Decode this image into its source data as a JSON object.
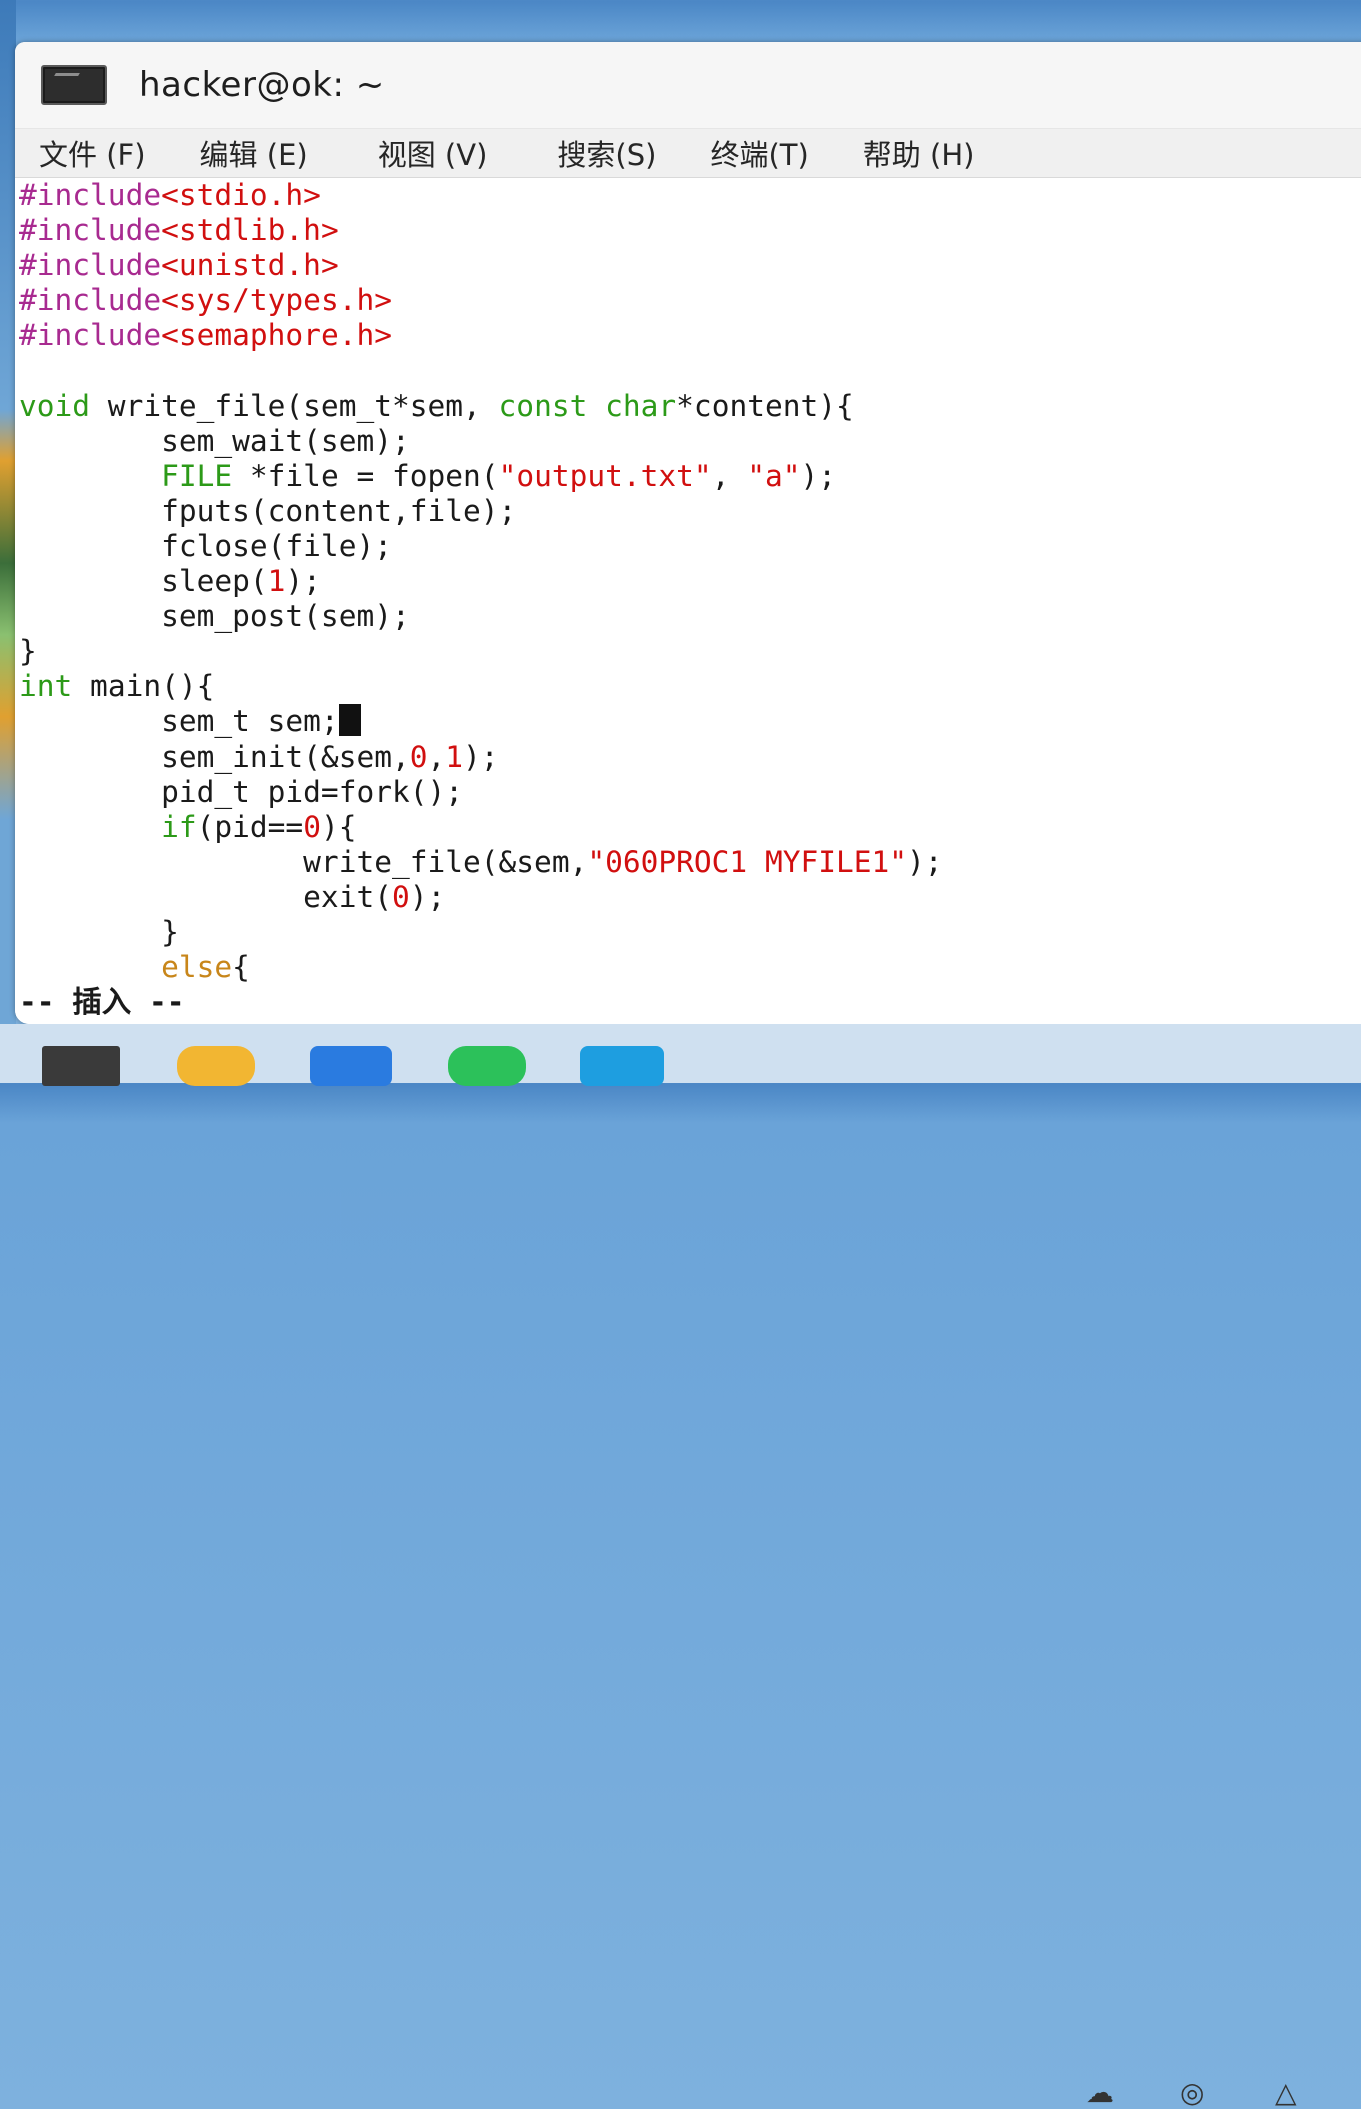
{
  "window": {
    "title": "hacker@ok: ~"
  },
  "menu": [
    "文件 (F)",
    "编辑 (E)",
    "视图 (V)",
    "搜索(S)",
    "终端(T)",
    "帮助 (H)"
  ],
  "code": {
    "includes": [
      {
        "directive": "#include",
        "header": "<stdio.h>"
      },
      {
        "directive": "#include",
        "header": "<stdlib.h>"
      },
      {
        "directive": "#include",
        "header": "<unistd.h>"
      },
      {
        "directive": "#include",
        "header": "<sys/types.h>"
      },
      {
        "directive": "#include",
        "header": "<semaphore.h>"
      }
    ],
    "fn_sig": {
      "ret": "void",
      "name": " write_file(sem_t*sem, ",
      "kw1": "const",
      "kw2": "char",
      "rest": "*content){"
    },
    "fn_body": {
      "l1": "        sem_wait(sem);",
      "l2_type": "FILE",
      "l2_a": " *file = fopen(",
      "l2_s1": "\"output.txt\"",
      "l2_b": ", ",
      "l2_s2": "\"a\"",
      "l2_c": ");",
      "l3": "        fputs(content,file);",
      "l4": "        fclose(file);",
      "l5_a": "        sleep(",
      "l5_n": "1",
      "l5_b": ");",
      "l6": "        sem_post(sem);",
      "close": "}"
    },
    "main": {
      "kw": "int",
      "sig": " main(){",
      "l1": "        sem_t sem;",
      "l2_a": "        sem_init(&sem,",
      "l2_n1": "0",
      "l2_b": ",",
      "l2_n2": "1",
      "l2_c": ");",
      "l3": "        pid_t pid=fork();",
      "l4_kw": "if",
      "l4_a": "(pid==",
      "l4_n": "0",
      "l4_b": "){",
      "l5_a": "                write_file(&sem,",
      "l5_s": "\"060PROC1 MYFILE1\"",
      "l5_b": ");",
      "l6_a": "                exit(",
      "l6_n": "0",
      "l6_b": ");",
      "l7": "        }",
      "l8_kw": "else",
      "l8_b": "{"
    }
  },
  "status_line": "-- 插入 --",
  "colors": {
    "preprocessor": "#a82a90",
    "string": "#d10f0f",
    "keyword": "#2c9a18",
    "cursor": "#111111"
  },
  "taskbar_icons": [
    "terminal-icon",
    "install-icon",
    "mail-icon",
    "chat-icon",
    "layers-icon"
  ],
  "tray_icons": [
    "cloud-icon",
    "volume-icon",
    "network-icon"
  ]
}
